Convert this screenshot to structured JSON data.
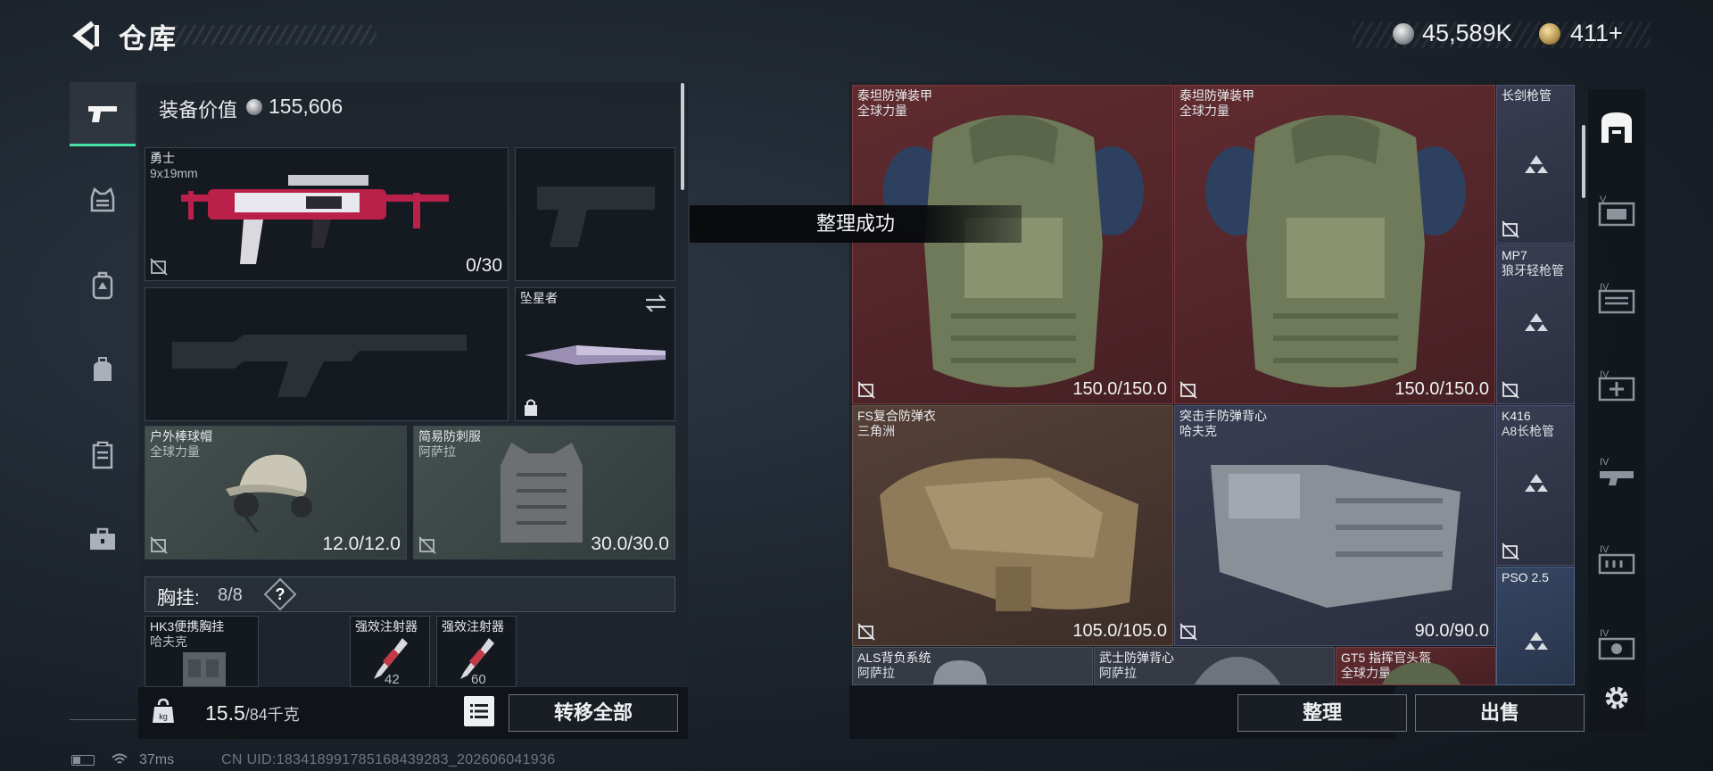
{
  "header": {
    "title": "仓库",
    "currency_silver": "45,589K",
    "currency_gold": "411+"
  },
  "left_panel": {
    "equip_value_label": "装备价值",
    "equip_value": "155,606",
    "primary_weapon": {
      "name": "勇士",
      "caliber": "9x19mm",
      "ammo": "0/30"
    },
    "melee": {
      "name": "坠星者"
    },
    "helmet": {
      "name": "户外棒球帽",
      "source": "全球力量",
      "durability": "12.0/12.0"
    },
    "armor": {
      "name": "简易防刺服",
      "source": "阿萨拉",
      "durability": "30.0/30.0"
    },
    "chest_rig": {
      "label": "胸挂:",
      "count": "8/8",
      "help": "?"
    },
    "rig_items": [
      {
        "name": "HK3便携胸挂",
        "source": "哈夫克"
      },
      {
        "name": "强效注射器",
        "count": "42"
      },
      {
        "name": "强效注射器",
        "count": "60"
      }
    ],
    "weight": "15.5",
    "weight_max": "/84千克",
    "transfer_all": "转移全部"
  },
  "toast": "整理成功",
  "stash": {
    "items": [
      {
        "name": "泰坦防弹装甲",
        "source": "全球力量",
        "durability": "150.0/150.0"
      },
      {
        "name": "泰坦防弹装甲",
        "source": "全球力量",
        "durability": "150.0/150.0"
      },
      {
        "name": "长剑枪管",
        "source": ""
      },
      {
        "name": "MP7",
        "source": "狼牙轻枪管"
      },
      {
        "name": "FS复合防弹衣",
        "source": "三角洲",
        "durability": "105.0/105.0"
      },
      {
        "name": "突击手防弹背心",
        "source": "哈夫克",
        "durability": "90.0/90.0"
      },
      {
        "name": "K416",
        "source": "A8长枪管"
      },
      {
        "name": "PSO 2.5",
        "source": ""
      },
      {
        "name": "ALS背负系统",
        "source": "阿萨拉"
      },
      {
        "name": "武士防弹背心",
        "source": "阿萨拉"
      },
      {
        "name": "GT5 指挥官头盔",
        "source": "全球力量"
      }
    ],
    "sort_button": "整理",
    "sell_button": "出售"
  },
  "right_tabs": [
    "V",
    "IV",
    "IV",
    "IV",
    "IV",
    "IV"
  ],
  "footer": {
    "ping": "37ms",
    "uid": "CN UID:1834189917851684392​83_202606041936"
  },
  "colors": {
    "accent": "#46e1a6",
    "red_cell": "#642c30",
    "blue_cell": "#384864"
  }
}
